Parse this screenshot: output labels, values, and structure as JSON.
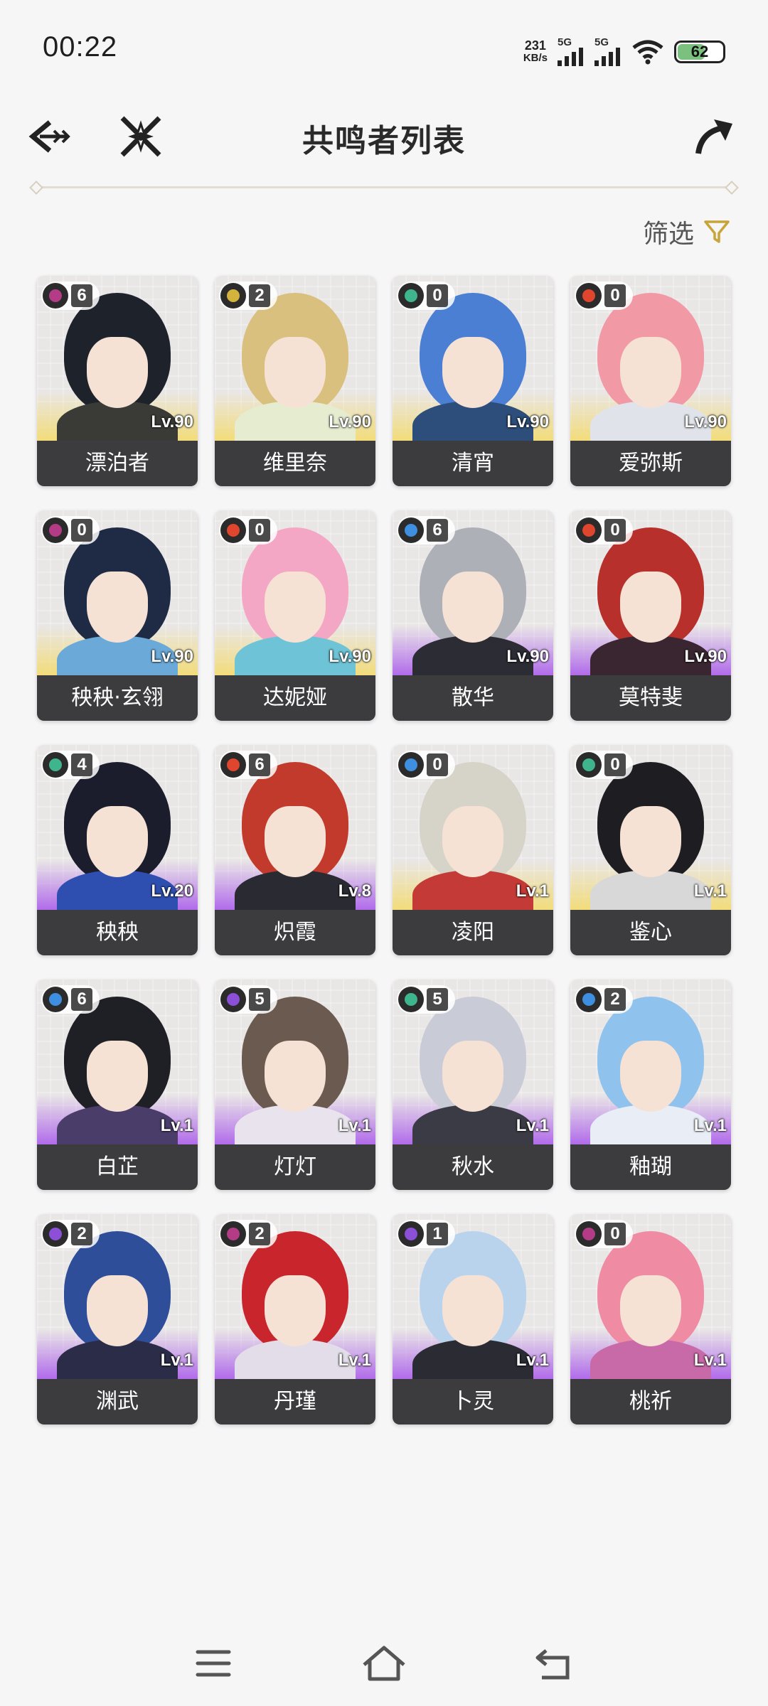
{
  "status_bar": {
    "time": "00:22",
    "net_speed_value": "231",
    "net_speed_unit": "KB/s",
    "sim1": "5G",
    "sim2": "5G",
    "battery": "62"
  },
  "header": {
    "title": "共鸣者列表",
    "back_icon": "back-arrow-icon",
    "cross_icon": "crossed-swords-icon",
    "share_icon": "share-arrow-icon"
  },
  "filter": {
    "label": "筛选",
    "icon": "filter-icon"
  },
  "colors": {
    "spectro": "#d4b33c",
    "havoc": "#b43b86",
    "aero": "#3fb58d",
    "fusion": "#e0452e",
    "glacio": "#3f8fe0",
    "electro": "#8b4fd8",
    "five_star_glow": "#f2dc7a",
    "four_star_glow": "#b16bea"
  },
  "characters": [
    {
      "name": "漂泊者",
      "level": "Lv.90",
      "chain": "6",
      "element": "havoc",
      "rarity": 5,
      "hair": "#1e222b",
      "outfit": "#3a3b36"
    },
    {
      "name": "维里奈",
      "level": "Lv.90",
      "chain": "2",
      "element": "spectro",
      "rarity": 5,
      "hair": "#d9c07e",
      "outfit": "#e6ecd0"
    },
    {
      "name": "清宵",
      "level": "Lv.90",
      "chain": "0",
      "element": "aero",
      "rarity": 5,
      "hair": "#4a7fd3",
      "outfit": "#2d4e7a"
    },
    {
      "name": "爱弥斯",
      "level": "Lv.90",
      "chain": "0",
      "element": "fusion",
      "rarity": 5,
      "hair": "#f19aa6",
      "outfit": "#e0e4ea"
    },
    {
      "name": "秧秧·玄翎",
      "level": "Lv.90",
      "chain": "0",
      "element": "havoc",
      "rarity": 5,
      "hair": "#1f2a44",
      "outfit": "#6aa9d8"
    },
    {
      "name": "达妮娅",
      "level": "Lv.90",
      "chain": "0",
      "element": "fusion",
      "rarity": 5,
      "hair": "#f4a7c4",
      "outfit": "#6ec3d6"
    },
    {
      "name": "散华",
      "level": "Lv.90",
      "chain": "6",
      "element": "glacio",
      "rarity": 4,
      "hair": "#aeb0b8",
      "outfit": "#2c2c35"
    },
    {
      "name": "莫特斐",
      "level": "Lv.90",
      "chain": "0",
      "element": "fusion",
      "rarity": 4,
      "hair": "#b8302c",
      "outfit": "#3a2630"
    },
    {
      "name": "秧秧",
      "level": "Lv.20",
      "chain": "4",
      "element": "aero",
      "rarity": 4,
      "hair": "#1b1d2d",
      "outfit": "#2e4fb0"
    },
    {
      "name": "炽霞",
      "level": "Lv.8",
      "chain": "6",
      "element": "fusion",
      "rarity": 4,
      "hair": "#c23a2c",
      "outfit": "#2a2a32"
    },
    {
      "name": "凌阳",
      "level": "Lv.1",
      "chain": "0",
      "element": "glacio",
      "rarity": 5,
      "hair": "#d6d3c8",
      "outfit": "#c43a36"
    },
    {
      "name": "鉴心",
      "level": "Lv.1",
      "chain": "0",
      "element": "aero",
      "rarity": 5,
      "hair": "#1e1e22",
      "outfit": "#d8d8d8"
    },
    {
      "name": "白芷",
      "level": "Lv.1",
      "chain": "6",
      "element": "glacio",
      "rarity": 4,
      "hair": "#1f1f26",
      "outfit": "#4a3d6a"
    },
    {
      "name": "灯灯",
      "level": "Lv.1",
      "chain": "5",
      "element": "electro",
      "rarity": 4,
      "hair": "#6b5a4f",
      "outfit": "#e8e3ec"
    },
    {
      "name": "秋水",
      "level": "Lv.1",
      "chain": "5",
      "element": "aero",
      "rarity": 4,
      "hair": "#c9ccd6",
      "outfit": "#3b3b46"
    },
    {
      "name": "釉瑚",
      "level": "Lv.1",
      "chain": "2",
      "element": "glacio",
      "rarity": 4,
      "hair": "#8fc2ec",
      "outfit": "#e9eef6"
    },
    {
      "name": "渊武",
      "level": "Lv.1",
      "chain": "2",
      "element": "electro",
      "rarity": 4,
      "hair": "#2f4e9a",
      "outfit": "#2b2d48"
    },
    {
      "name": "丹瑾",
      "level": "Lv.1",
      "chain": "2",
      "element": "havoc",
      "rarity": 4,
      "hair": "#c9252d",
      "outfit": "#e2dde8"
    },
    {
      "name": "卜灵",
      "level": "Lv.1",
      "chain": "1",
      "element": "electro",
      "rarity": 4,
      "hair": "#b9d3ec",
      "outfit": "#2a2b33"
    },
    {
      "name": "桃祈",
      "level": "Lv.1",
      "chain": "0",
      "element": "havoc",
      "rarity": 4,
      "hair": "#ef8ba3",
      "outfit": "#c96aa8"
    }
  ],
  "nav_bar": {
    "menu_icon": "menu-icon",
    "home_icon": "home-icon",
    "back_icon": "back-icon"
  }
}
